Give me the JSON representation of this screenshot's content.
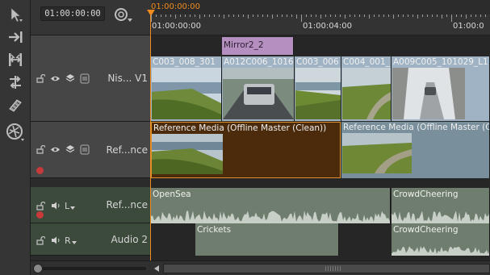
{
  "toolbar": {
    "tools": [
      "select-tool-icon",
      "track-select-forward-icon",
      "slip-tool-icon",
      "slide-tool-icon",
      "razor-tool-icon",
      "multi-tool-icon"
    ]
  },
  "timecode": {
    "current": "01:00:00:00"
  },
  "ruler": {
    "playhead_tc": "01:00:00:00",
    "labels": [
      "01:00:00:00",
      "01:00:04:00",
      "01:00:0"
    ]
  },
  "tracks": {
    "v1": {
      "name": "Nis... V1"
    },
    "ref": {
      "name": "Ref...nce"
    },
    "a1": {
      "name": "Ref...nce",
      "channel": "L"
    },
    "a2": {
      "name": "Audio 2",
      "channel": "R"
    }
  },
  "clips": {
    "mirror": "Mirror2_2",
    "v1": [
      "C003_008_301",
      "A012C006_1016",
      "C003_006",
      "C004_001_",
      "A009C005_101029_L1"
    ],
    "ref": [
      "Reference Media (Offline Master (Clean))",
      "Reference Media (Offline Master (C"
    ],
    "a1": [
      "OpenSea",
      "CrowdCheering"
    ],
    "a2": [
      "Crickets",
      "CrowdCheering"
    ]
  },
  "colors": {
    "playhead": "#f08c1e",
    "mirror_clip": "#b68fc1",
    "ref_clip_selected": "#4b2b0c",
    "ref_clip": "#7a8f9c",
    "audio_clip": "#6f7d6e",
    "record_dot": "#c8393b"
  }
}
